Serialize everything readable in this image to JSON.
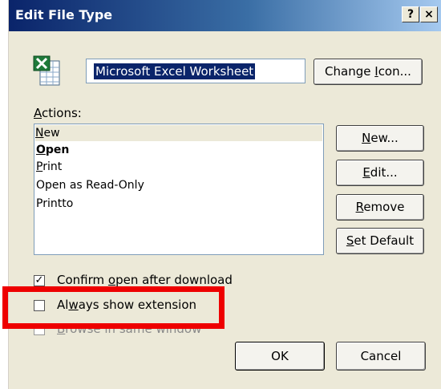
{
  "window": {
    "title": "Edit File Type",
    "help_glyph": "?",
    "close_glyph": "×"
  },
  "file_type": {
    "name": "Microsoft Excel Worksheet",
    "icon": "excel-worksheet-icon",
    "change_icon_label_pre": "Change ",
    "change_icon_label_u": "I",
    "change_icon_label_post": "con..."
  },
  "actions": {
    "label_u": "A",
    "label_rest": "ctions:",
    "items": [
      {
        "u": "N",
        "rest": "ew",
        "selected": true,
        "bold": false
      },
      {
        "u": "O",
        "rest": "pen",
        "selected": false,
        "bold": true
      },
      {
        "u": "P",
        "rest": "rint",
        "selected": false,
        "bold": false
      },
      {
        "u": "",
        "rest": "Open as Read-Only",
        "selected": false,
        "bold": false
      },
      {
        "u": "",
        "rest": "Printto",
        "selected": false,
        "bold": false
      }
    ],
    "buttons": {
      "new": {
        "u": "N",
        "rest": "ew..."
      },
      "edit": {
        "u": "E",
        "rest": "dit..."
      },
      "remove": {
        "u": "R",
        "rest": "emove"
      },
      "set_default": {
        "u": "S",
        "rest": "et Default"
      }
    }
  },
  "options": {
    "confirm_open": {
      "pre": "Confirm ",
      "u": "o",
      "post": "pen after download",
      "checked": true
    },
    "always_show_ext": {
      "pre": "Al",
      "u": "w",
      "post": "ays show extension",
      "checked": false
    },
    "browse_same_window": {
      "pre": "",
      "u": "B",
      "post": "rowse in same window",
      "checked": false
    }
  },
  "footer": {
    "ok_label": "OK",
    "cancel_label": "Cancel"
  },
  "colors": {
    "highlight": "#ee0000",
    "title_bar_start": "#0a246a",
    "dialog_face": "#ece9d8"
  }
}
